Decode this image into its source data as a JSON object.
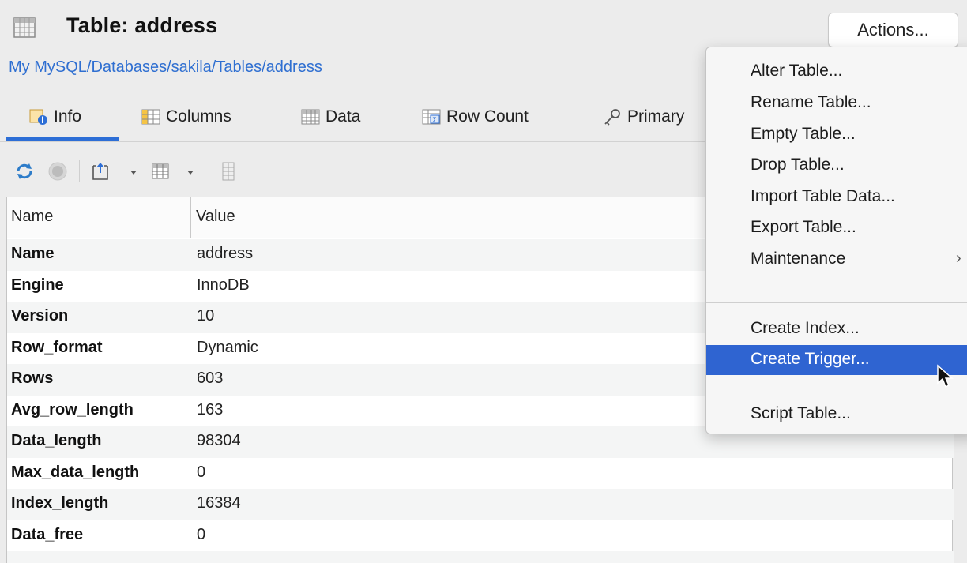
{
  "header": {
    "title": "Table: address",
    "actions_label": "Actions...",
    "breadcrumb": "My MySQL/Databases/sakila/Tables/address"
  },
  "tabs": [
    {
      "label": "Info",
      "icon": "info-icon"
    },
    {
      "label": "Columns",
      "icon": "columns-icon"
    },
    {
      "label": "Data",
      "icon": "data-grid-icon"
    },
    {
      "label": "Row Count",
      "icon": "row-count-icon"
    },
    {
      "label": "Primary",
      "icon": "key-icon"
    }
  ],
  "toolbar": {
    "icons": [
      "refresh-icon",
      "stop-icon",
      "export-icon",
      "dropdown-icon",
      "grid-icon",
      "dropdown-icon",
      "properties-icon"
    ]
  },
  "grid": {
    "columns": [
      "Name",
      "Value"
    ],
    "rows": [
      {
        "name": "Name",
        "value": "address"
      },
      {
        "name": "Engine",
        "value": "InnoDB"
      },
      {
        "name": "Version",
        "value": "10"
      },
      {
        "name": "Row_format",
        "value": "Dynamic"
      },
      {
        "name": "Rows",
        "value": "603"
      },
      {
        "name": "Avg_row_length",
        "value": "163"
      },
      {
        "name": "Data_length",
        "value": "98304"
      },
      {
        "name": "Max_data_length",
        "value": "0"
      },
      {
        "name": "Index_length",
        "value": "16384"
      },
      {
        "name": "Data_free",
        "value": "0"
      }
    ]
  },
  "menu": {
    "items": [
      {
        "label": "Alter Table..."
      },
      {
        "label": "Rename Table..."
      },
      {
        "label": "Empty Table..."
      },
      {
        "label": "Drop Table..."
      },
      {
        "label": "Import Table Data..."
      },
      {
        "label": "Export Table..."
      },
      {
        "label": "Maintenance",
        "submenu": true
      },
      {
        "label": "Create Index..."
      },
      {
        "label": "Create Trigger...",
        "highlighted": true
      },
      {
        "label": "Script Table..."
      }
    ]
  },
  "colors": {
    "accent": "#2d6ed6",
    "menu_highlight": "#2f64d1",
    "link": "#2f6fd1",
    "background": "#ececec"
  }
}
